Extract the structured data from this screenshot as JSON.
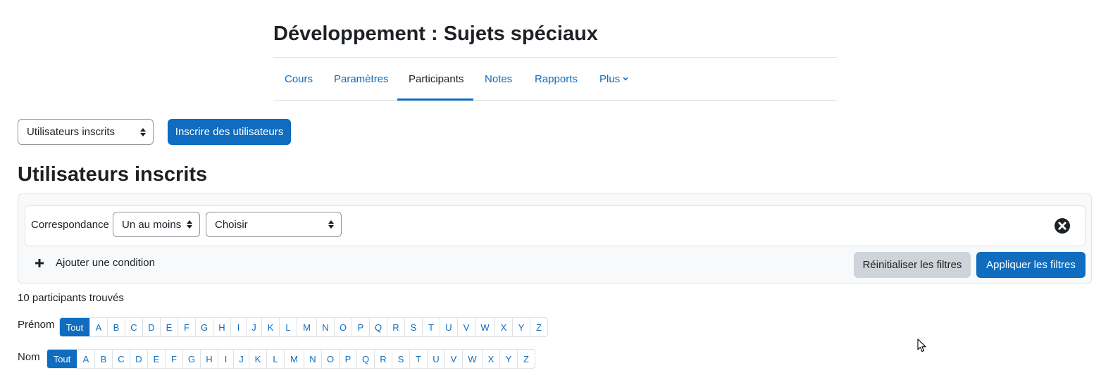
{
  "course": {
    "title": "Développement : Sujets spéciaux"
  },
  "nav": {
    "items": [
      {
        "label": "Cours"
      },
      {
        "label": "Paramètres"
      },
      {
        "label": "Participants"
      },
      {
        "label": "Notes"
      },
      {
        "label": "Rapports"
      },
      {
        "label": "Plus"
      }
    ],
    "active": "Participants"
  },
  "toolbar": {
    "view_select": "Utilisateurs inscrits",
    "enrol_button": "Inscrire des utilisateurs"
  },
  "page": {
    "heading": "Utilisateurs inscrits"
  },
  "filters": {
    "match_label": "Correspondance",
    "match_select": "Un au moins",
    "type_select": "Choisir",
    "add_condition": "Ajouter une condition",
    "reset_button": "Réinitialiser les filtres",
    "apply_button": "Appliquer les filtres"
  },
  "results": {
    "count_text": "10 participants trouvés"
  },
  "initials": {
    "all": "Tout",
    "letters": [
      "A",
      "B",
      "C",
      "D",
      "E",
      "F",
      "G",
      "H",
      "I",
      "J",
      "K",
      "L",
      "M",
      "N",
      "O",
      "P",
      "Q",
      "R",
      "S",
      "T",
      "U",
      "V",
      "W",
      "X",
      "Y",
      "Z"
    ],
    "firstname": {
      "label": "Prénom",
      "selected": "Tout"
    },
    "lastname": {
      "label": "Nom",
      "selected": "Tout"
    }
  },
  "colors": {
    "primary": "#0f6cbf",
    "text": "#1d2125",
    "border": "#dee2e6",
    "secondary_btn": "#ced4da",
    "panel_bg": "#f8f9fa"
  },
  "icons": {
    "more_caret": "chevron-down-icon",
    "select_arrows": "sort-updown-icon",
    "remove_filter": "times-circle-icon",
    "add": "plus-icon"
  }
}
